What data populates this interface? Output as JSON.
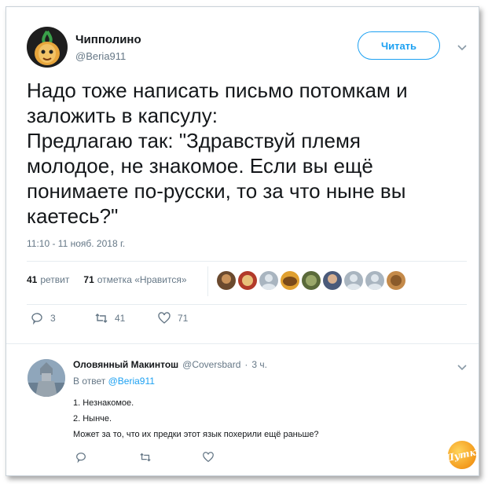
{
  "tweet": {
    "author_name": "Чипполино",
    "author_handle": "@Beria911",
    "follow_label": "Читать",
    "text": "Надо тоже написать письмо потомкам и\nзаложить в капсулу:\nПредлагаю так:  \"Здравствуй племя\nмолодое, не знакомое. Если вы ещё\nпонимаете по-русски, то за что ныне вы\nкаетесь?\"",
    "timestamp": "11:10 - 11 нояб. 2018 г.",
    "retweets_count": "41",
    "retweets_label": "ретвит",
    "likes_count": "71",
    "likes_label": "отметка «Нравится»",
    "actions": {
      "replies": "3",
      "retweets": "41",
      "likes": "71"
    }
  },
  "reply": {
    "author_name": "Оловянный Макинтош",
    "author_handle": "@Coversbard",
    "separator": "·",
    "time": "3 ч.",
    "in_reply_prefix": "В ответ",
    "in_reply_handle": "@Beria911",
    "lines": [
      "1. Незнакомое.",
      "2. Нынче.",
      "Может за то, что их предки этот язык похерили ещё раньше?"
    ]
  },
  "watermark": {
    "text": "Шутка"
  },
  "colors": {
    "accent": "#1da1f2",
    "muted": "#657786",
    "text": "#14171a",
    "border": "#e6ecf0"
  },
  "icons": [
    "chevron-down-icon",
    "reply-icon",
    "retweet-icon",
    "heart-icon"
  ]
}
